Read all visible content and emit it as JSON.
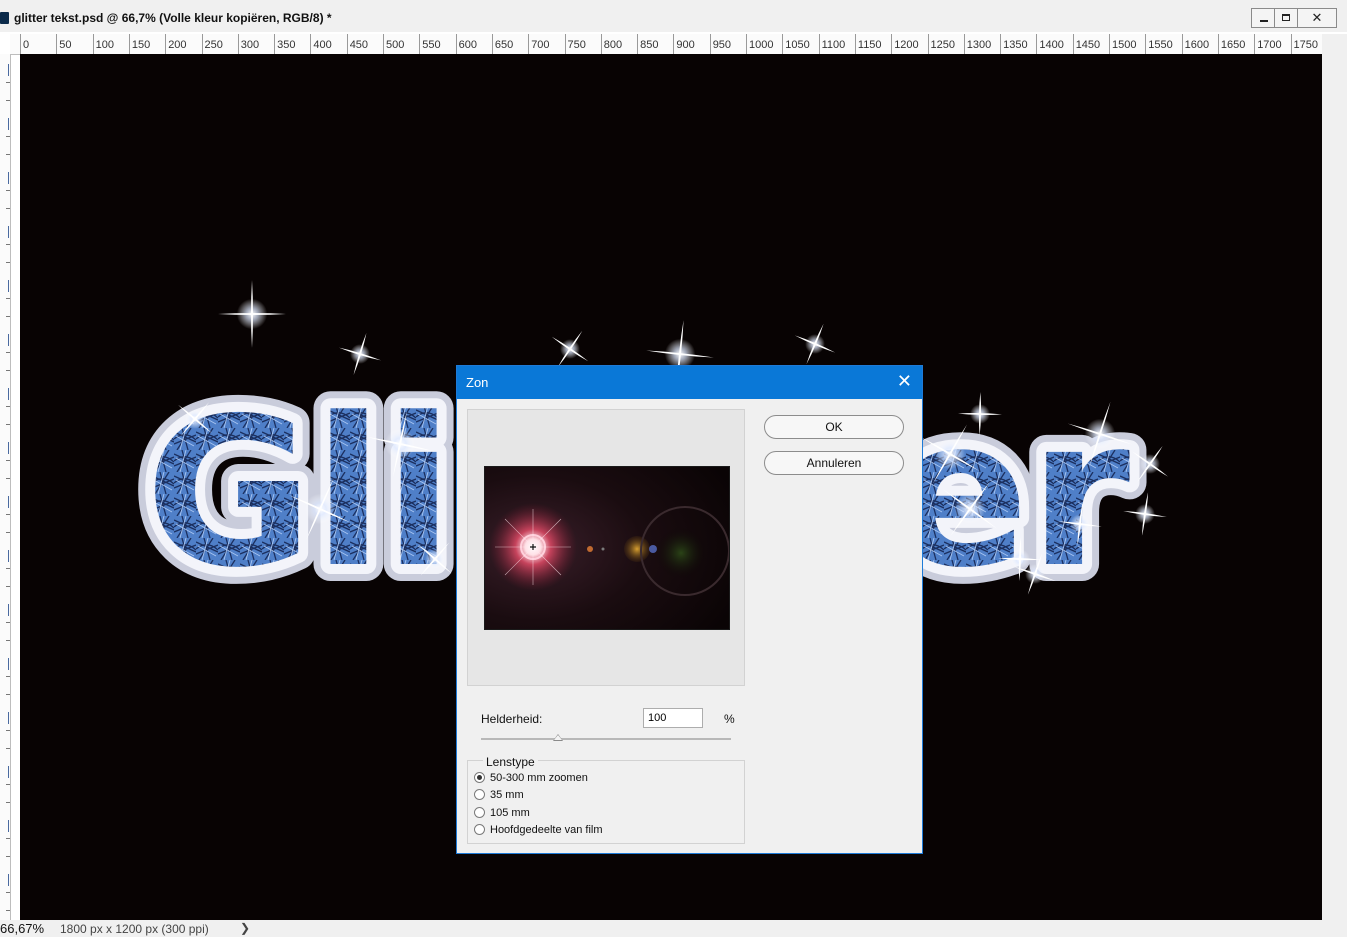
{
  "window": {
    "title": "glitter tekst.psd @ 66,7% (Volle kleur kopiëren, RGB/8) *",
    "close_glyph": "✕"
  },
  "ruler": {
    "labels": [
      "0",
      "50",
      "100",
      "150",
      "200",
      "250",
      "300",
      "350",
      "400",
      "450",
      "500",
      "550",
      "600",
      "650",
      "700",
      "750",
      "800",
      "850",
      "900",
      "950",
      "1000",
      "1050",
      "1100",
      "1150",
      "1200",
      "1250",
      "1300",
      "1350",
      "1400",
      "1450",
      "1500",
      "1550",
      "1600",
      "1650",
      "1700",
      "1750"
    ]
  },
  "canvas": {
    "background": "#080303",
    "text_art": "Glitter",
    "letter_fill": "#4f7fc8",
    "outline": "#d4d6e6"
  },
  "statusbar": {
    "zoom": "66,67%",
    "doc_size": "1800 px x 1200 px (300 ppi)",
    "arrow": "❯"
  },
  "dialog": {
    "title": "Zon",
    "close_glyph": "✕",
    "ok_label": "OK",
    "cancel_label": "Annuleren",
    "brightness_label": "Helderheid:",
    "brightness_value": "100",
    "brightness_unit": "%",
    "brightness_slider_value": 100,
    "lens_group_label": "Lenstype",
    "lens_options": [
      {
        "label": "50-300 mm zoomen",
        "selected": true
      },
      {
        "label": "35 mm",
        "selected": false
      },
      {
        "label": "105 mm",
        "selected": false
      },
      {
        "label": "Hoofdgedeelte van film",
        "selected": false
      }
    ],
    "accent": "#0a78d7"
  }
}
